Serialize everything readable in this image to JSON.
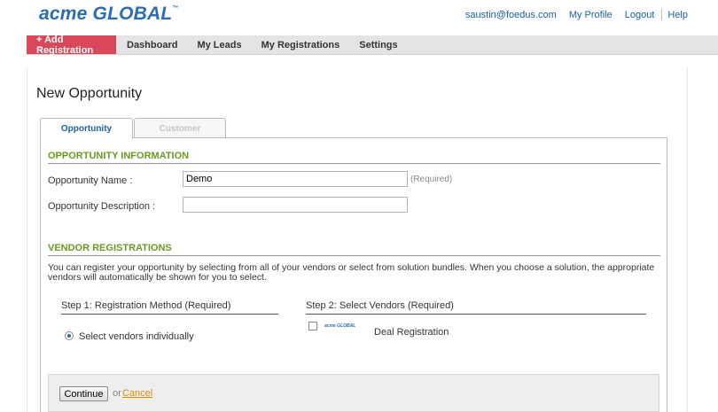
{
  "header": {
    "logo_text": "acme GLOBAL",
    "logo_mark": "™",
    "user_email": "saustin@foedus.com",
    "my_profile": "My Profile",
    "logout": "Logout",
    "help": "Help"
  },
  "nav": {
    "add_registration": "+ Add Registration",
    "items": [
      "Dashboard",
      "My Leads",
      "My Registrations",
      "Settings"
    ]
  },
  "page": {
    "title": "New Opportunity",
    "tabs": [
      {
        "label": "Opportunity",
        "active": true
      },
      {
        "label": "Customer",
        "active": false
      }
    ]
  },
  "opportunity_info": {
    "section_title": "OPPORTUNITY INFORMATION",
    "name_label": "Opportunity Name :",
    "name_value": "Demo",
    "required_text": "(Required)",
    "description_label": "Opportunity Description :",
    "description_value": ""
  },
  "vendor_registrations": {
    "section_title": "VENDOR REGISTRATIONS",
    "description": "You can register your opportunity by selecting from all of your vendors or select from solution bundles. When you choose a solution, the appropriate vendors will automatically be shown for you to select.",
    "step1_heading": "Step 1: Registration Method (Required)",
    "step1_option": "Select vendors individually",
    "step1_selected": true,
    "step2_heading": "Step 2: Select Vendors (Required)",
    "vendors": [
      {
        "logo_text": "acme GLOBAL",
        "name": "Deal Registration",
        "checked": false
      }
    ]
  },
  "actions": {
    "continue_label": "Continue",
    "or_text": "or",
    "cancel_label": "Cancel"
  },
  "colors": {
    "brand_blue": "#2a6db5",
    "add_button_red": "#d9485a",
    "section_green": "#6a9a1f",
    "cancel_orange": "#e08a00"
  }
}
